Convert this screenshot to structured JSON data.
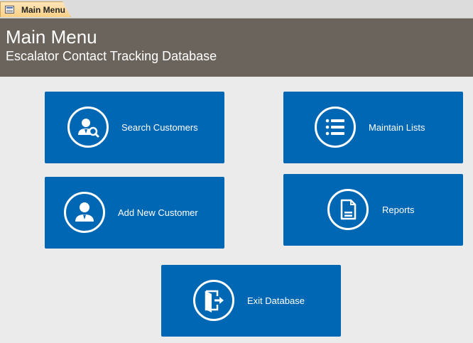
{
  "tab": {
    "label": "Main Menu",
    "icon": "form-icon"
  },
  "header": {
    "title": "Main Menu",
    "subtitle": "Escalator Contact Tracking Database"
  },
  "tiles": [
    {
      "label": "Search Customers",
      "icon": "search-user-icon"
    },
    {
      "label": "Maintain Lists",
      "icon": "list-icon"
    },
    {
      "label": "Add New Customer",
      "icon": "user-icon"
    },
    {
      "label": "Reports",
      "icon": "document-icon"
    },
    {
      "label": "Exit Database",
      "icon": "exit-door-icon"
    }
  ],
  "colors": {
    "header_bg": "#6b645c",
    "tile_bg": "#0067b4",
    "page_bg": "#ebebeb"
  }
}
